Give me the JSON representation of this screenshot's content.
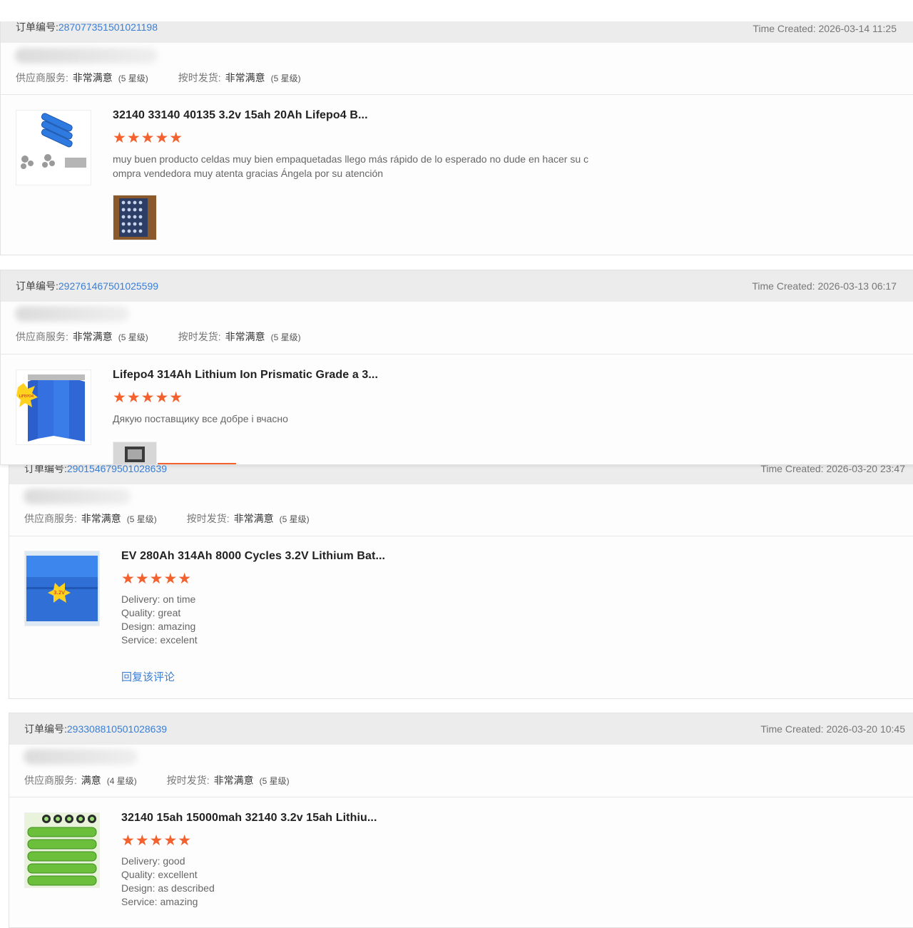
{
  "labels": {
    "order_no": "订单编号:",
    "time_created": "Time Created: ",
    "supplier_service": "供应商服务:",
    "on_time_delivery": "按时发货:",
    "reply": "回复该评论"
  },
  "colors": {
    "accent_star": "#f2612e",
    "link": "#3a7fd5",
    "header_bg": "#ececec"
  },
  "orders": [
    {
      "order_number": "287077351501021198",
      "time_created": "2026-03-14 11:25",
      "supplier_service": "非常满意",
      "supplier_level": "(5 星级)",
      "delivery_rating": "非常满意",
      "delivery_level": "(5 星级)",
      "product_title": "32140 33140 40135 3.2v 15ah 20Ah Lifepo4 B...",
      "stars": "★★★★★",
      "review_lines": [
        "muy buen producto celdas muy bien empaquetadas llego más rápido de lo esperado no dude en hacer su c",
        "ompra vendedora muy atenta gracias Ángela por su atención"
      ],
      "product_icon": "blue-cylinder-cells-image",
      "photo_icon": "battery-pack-photo"
    },
    {
      "order_number": "292761467501025599",
      "time_created": "2026-03-13 06:17",
      "supplier_service": "非常满意",
      "supplier_level": "(5 星级)",
      "delivery_rating": "非常满意",
      "delivery_level": "(5 星级)",
      "product_title": "Lifepo4 314Ah Lithium Ion Prismatic Grade a 3...",
      "stars": "★★★★★",
      "review_lines": [
        "Дякую поставщику все добре і вчасно"
      ],
      "product_icon": "blue-prismatic-cells-image",
      "photo_icon": "package-photo"
    },
    {
      "order_number": "290154679501028639",
      "time_created": "2026-03-20 23:47",
      "supplier_service": "非常满意",
      "supplier_level": "(5 星级)",
      "delivery_rating": "非常满意",
      "delivery_level": "(5 星级)",
      "product_title": "EV 280Ah 314Ah 8000 Cycles 3.2V Lithium Bat...",
      "stars": "★★★★★",
      "details": [
        {
          "key": "Delivery:",
          "value": "on time"
        },
        {
          "key": "Quality:",
          "value": "great"
        },
        {
          "key": "Design:",
          "value": "amazing"
        },
        {
          "key": "Service:",
          "value": "excelent"
        }
      ],
      "product_icon": "blue-prismatic-battery-image"
    },
    {
      "order_number": "293308810501028639",
      "time_created": "2026-03-20 10:45",
      "supplier_service": "满意",
      "supplier_level": "(4 星级)",
      "delivery_rating": "非常满意",
      "delivery_level": "(5 星级)",
      "product_title": "32140 15ah 15000mah 32140 3.2v 15ah Lithiu...",
      "stars": "★★★★★",
      "details": [
        {
          "key": "Delivery:",
          "value": "good"
        },
        {
          "key": "Quality:",
          "value": "excellent"
        },
        {
          "key": "Design:",
          "value": "as described"
        },
        {
          "key": "Service:",
          "value": "amazing"
        }
      ],
      "product_icon": "green-cylinder-cells-image"
    }
  ]
}
